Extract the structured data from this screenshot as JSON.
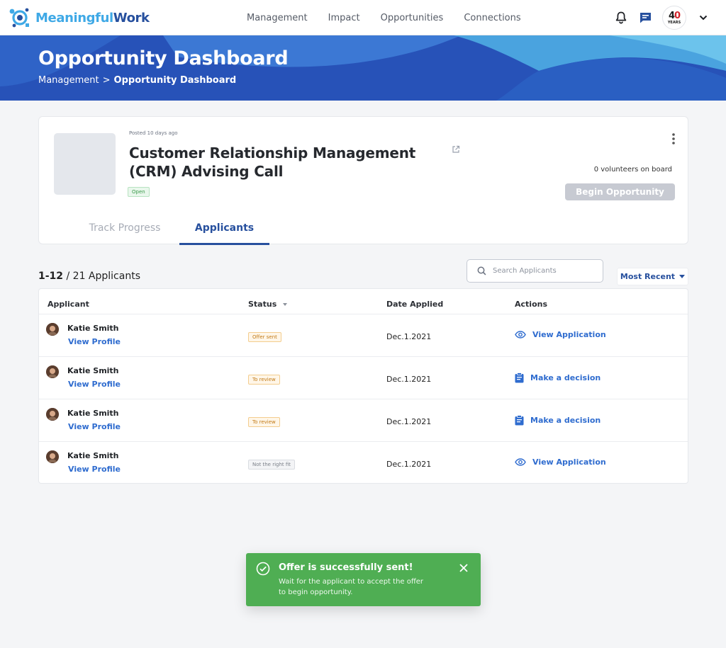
{
  "brand": {
    "name_part1": "Meaningful",
    "name_part2": "Work",
    "color_light": "#3fa9e6",
    "color_dark": "#27509e"
  },
  "nav": {
    "links": [
      "Management",
      "Impact",
      "Opportunities",
      "Connections"
    ]
  },
  "nav_icons": [
    "bell-icon",
    "chat-icon",
    "chevron-down-icon"
  ],
  "org_badge": {
    "big_text": "4",
    "big_text_accent": "0",
    "small_text": "YEARS"
  },
  "hero": {
    "title": "Opportunity Dashboard",
    "breadcrumb": [
      "Management",
      ">",
      "Opportunity Dashboard"
    ],
    "color": "#2752b8"
  },
  "opportunity": {
    "posted": "Posted 10 days ago",
    "title": "Customer Relationship Management (CRM) Advising Call",
    "status": "Open",
    "volunteers": "0 volunteers on board",
    "begin_label": "Begin Opportunity"
  },
  "tabs": [
    {
      "label": "Track Progress",
      "active": false
    },
    {
      "label": "Applicants",
      "active": true
    }
  ],
  "applicants": {
    "range": "1-12",
    "total_text": " / 21 Applicants",
    "search_placeholder": "Search Applicants",
    "sort_label": "Most Recent",
    "columns": [
      "Applicant",
      "Status",
      "Date Applied",
      "Actions"
    ],
    "rows": [
      {
        "name": "Katie Smith",
        "profile": "View Profile",
        "status": "Offer sent",
        "status_color": "orange",
        "date": "Dec.1.2021",
        "action": "View Application",
        "action_icon": "eye-icon"
      },
      {
        "name": "Katie Smith",
        "profile": "View Profile",
        "status": "To review",
        "status_color": "orange",
        "date": "Dec.1.2021",
        "action": "Make a decision",
        "action_icon": "clipboard-icon"
      },
      {
        "name": "Katie Smith",
        "profile": "View Profile",
        "status": "To review",
        "status_color": "orange",
        "date": "Dec.1.2021",
        "action": "Make a decision",
        "action_icon": "clipboard-icon"
      },
      {
        "name": "Katie Smith",
        "profile": "View Profile",
        "status": "Not the right fit",
        "status_color": "gray",
        "date": "Dec.1.2021",
        "action": "View Application",
        "action_icon": "eye-icon"
      }
    ]
  },
  "toast": {
    "title": "Offer is successfully sent!",
    "message": "Wait for the applicant to accept the offer to begin opportunity.",
    "color": "#4fae53"
  }
}
